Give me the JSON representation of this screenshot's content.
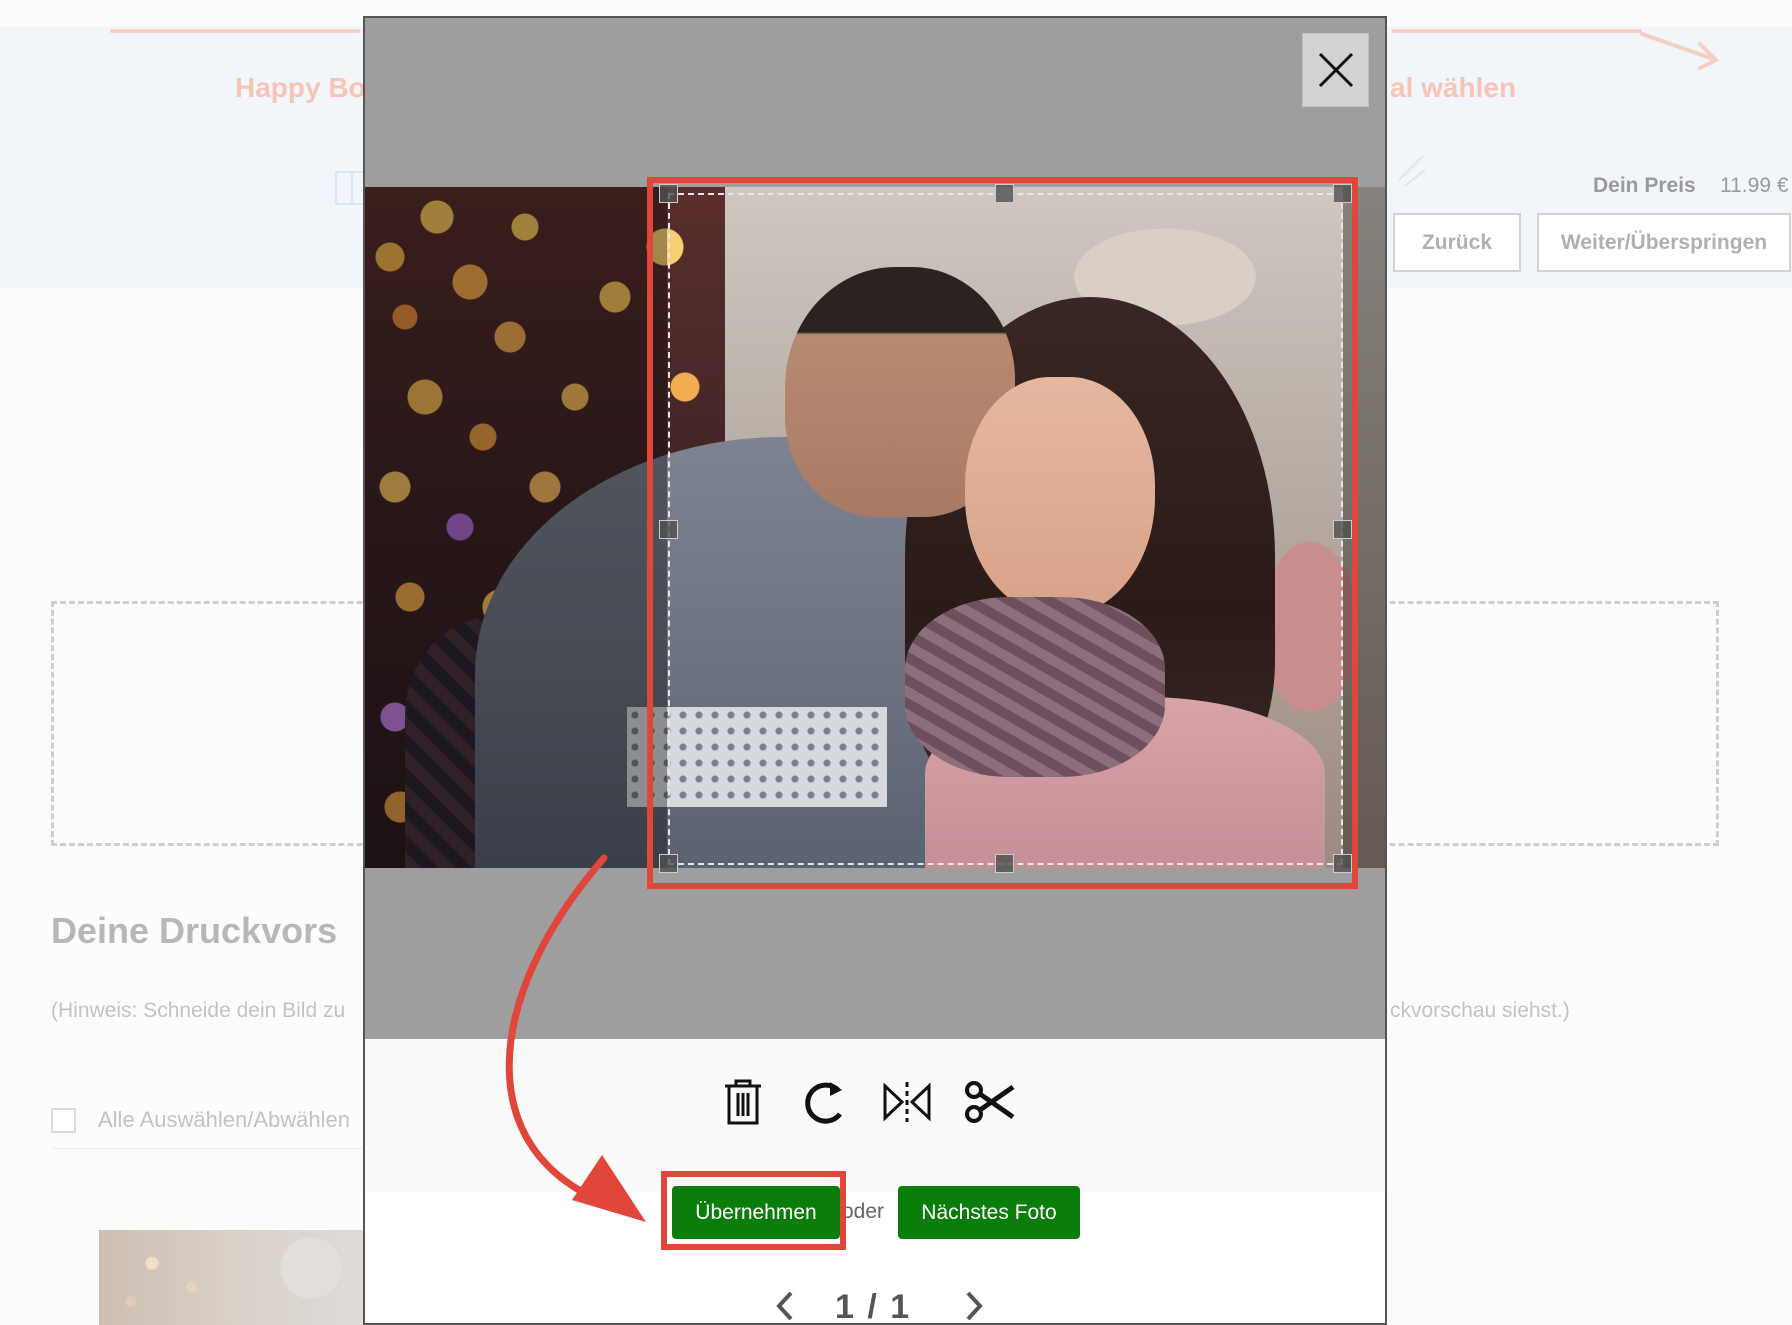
{
  "background_page": {
    "step_left_label": "Happy Bo",
    "step_right_label": "al wählen",
    "price_label": "Dein Preis",
    "price_value": "11.99 €",
    "back_button": "Zurück",
    "next_button": "Weiter/Überspringen",
    "preview_title": "Deine Druckvors",
    "hint_left": "(Hinweis: Schneide dein Bild zu",
    "hint_right": "ckvorschau siehst.)",
    "select_all_label": "Alle Auswählen/Abwählen"
  },
  "modal": {
    "close_icon": "close-icon",
    "tools": [
      {
        "name": "delete",
        "icon": "trash-icon"
      },
      {
        "name": "rotate",
        "icon": "rotate-icon"
      },
      {
        "name": "flip",
        "icon": "flip-icon"
      },
      {
        "name": "crop",
        "icon": "scissors-icon"
      }
    ],
    "apply_button": "Übernehmen",
    "or_text": "oder",
    "next_photo_button": "Nächstes Foto",
    "pager_text": "1 / 1"
  },
  "colors": {
    "highlight": "#e0463a",
    "button_green": "#0b7d0b",
    "step_accent": "#f7c4b6"
  }
}
